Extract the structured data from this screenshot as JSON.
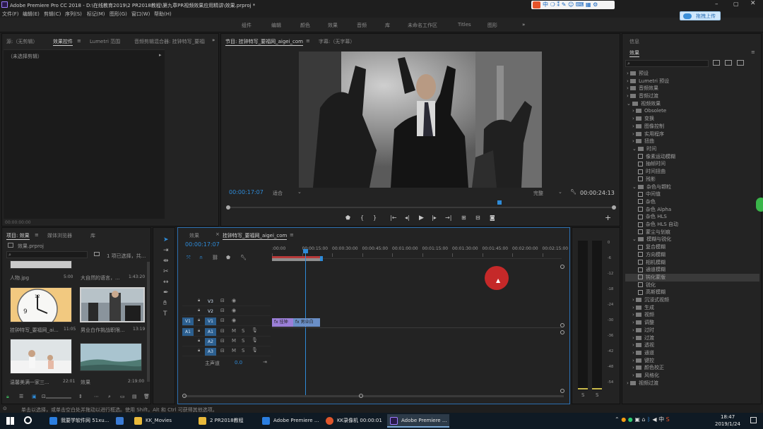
{
  "window": {
    "title": "Adobe Premiere Pro CC 2018 - D:\\在线教育2019\\2 PR2018教程\\第九章PR视频效果应用精讲\\效果.prproj *"
  },
  "menu": [
    "文件(F)",
    "编辑(E)",
    "剪辑(C)",
    "序列(S)",
    "标记(M)",
    "图形(G)",
    "窗口(W)",
    "帮助(H)"
  ],
  "workspaces": [
    "组件",
    "编辑",
    "颜色",
    "效果",
    "音频",
    "库",
    "未命名工作区",
    "Titles",
    "图形"
  ],
  "upload_button": "拖拽上传",
  "ime_bar": "中",
  "source_panel": {
    "tabs": [
      "源:（无剪辑）",
      "效果控件",
      "Lumetri 范围",
      "音频剪辑混合器: 挂钟特写_要福网_aigei_com"
    ],
    "no_clip": "（未选择剪辑）",
    "timecode": "00:00:00:00"
  },
  "program_panel": {
    "tabs": [
      "节目: 挂钟特写_要福网_aigei_com",
      "字幕:（无字幕）"
    ],
    "timecode": "00:00:17:07",
    "fit": "适合",
    "quality": "完整",
    "duration": "00:00:24:13"
  },
  "effects_panel": {
    "tab_info": "信息",
    "tab_effects": "效果",
    "search_placeholder": "",
    "tree": [
      {
        "label": "预设",
        "type": "folder",
        "indent": 1,
        "expanded": false
      },
      {
        "label": "Lumetri 预设",
        "type": "folder",
        "indent": 1,
        "expanded": false
      },
      {
        "label": "音频效果",
        "type": "folder",
        "indent": 1,
        "expanded": false
      },
      {
        "label": "音频过渡",
        "type": "folder",
        "indent": 1,
        "expanded": false
      },
      {
        "label": "视频效果",
        "type": "folder",
        "indent": 1,
        "expanded": true
      },
      {
        "label": "Obsolete",
        "type": "folder",
        "indent": 2,
        "expanded": false
      },
      {
        "label": "变换",
        "type": "folder",
        "indent": 2,
        "expanded": false
      },
      {
        "label": "图像控制",
        "type": "folder",
        "indent": 2,
        "expanded": false
      },
      {
        "label": "实用程序",
        "type": "folder",
        "indent": 2,
        "expanded": false
      },
      {
        "label": "扭曲",
        "type": "folder",
        "indent": 2,
        "expanded": false
      },
      {
        "label": "时间",
        "type": "folder",
        "indent": 2,
        "expanded": true
      },
      {
        "label": "像素运动模糊",
        "type": "effect",
        "indent": 3
      },
      {
        "label": "抽帧时间",
        "type": "effect",
        "indent": 3
      },
      {
        "label": "时间扭曲",
        "type": "effect",
        "indent": 3
      },
      {
        "label": "残影",
        "type": "effect",
        "indent": 3
      },
      {
        "label": "杂色与颗粒",
        "type": "folder",
        "indent": 2,
        "expanded": true
      },
      {
        "label": "中间值",
        "type": "effect",
        "indent": 3
      },
      {
        "label": "杂色",
        "type": "effect",
        "indent": 3
      },
      {
        "label": "杂色 Alpha",
        "type": "effect",
        "indent": 3
      },
      {
        "label": "杂色 HLS",
        "type": "effect",
        "indent": 3
      },
      {
        "label": "杂色 HLS 自动",
        "type": "effect",
        "indent": 3
      },
      {
        "label": "蒙尘与划痕",
        "type": "effect",
        "indent": 3
      },
      {
        "label": "模糊与锐化",
        "type": "folder",
        "indent": 2,
        "expanded": true
      },
      {
        "label": "复合模糊",
        "type": "effect",
        "indent": 3
      },
      {
        "label": "方向模糊",
        "type": "effect",
        "indent": 3
      },
      {
        "label": "相机模糊",
        "type": "effect",
        "indent": 3
      },
      {
        "label": "通道模糊",
        "type": "effect",
        "indent": 3
      },
      {
        "label": "钝化蒙版",
        "type": "effect",
        "indent": 3,
        "selected": true
      },
      {
        "label": "锐化",
        "type": "effect",
        "indent": 3
      },
      {
        "label": "高斯模糊",
        "type": "effect",
        "indent": 3
      },
      {
        "label": "沉浸式视频",
        "type": "folder",
        "indent": 2,
        "expanded": false
      },
      {
        "label": "生成",
        "type": "folder",
        "indent": 2,
        "expanded": false
      },
      {
        "label": "视频",
        "type": "folder",
        "indent": 2,
        "expanded": false
      },
      {
        "label": "调整",
        "type": "folder",
        "indent": 2,
        "expanded": false
      },
      {
        "label": "过时",
        "type": "folder",
        "indent": 2,
        "expanded": false
      },
      {
        "label": "过渡",
        "type": "folder",
        "indent": 2,
        "expanded": false
      },
      {
        "label": "透视",
        "type": "folder",
        "indent": 2,
        "expanded": false
      },
      {
        "label": "通道",
        "type": "folder",
        "indent": 2,
        "expanded": false
      },
      {
        "label": "键控",
        "type": "folder",
        "indent": 2,
        "expanded": false
      },
      {
        "label": "颜色校正",
        "type": "folder",
        "indent": 2,
        "expanded": false
      },
      {
        "label": "风格化",
        "type": "folder",
        "indent": 2,
        "expanded": false
      },
      {
        "label": "视频过渡",
        "type": "folder",
        "indent": 1,
        "expanded": false
      }
    ]
  },
  "project_panel": {
    "tabs": [
      "项目: 效果",
      "媒体浏览器",
      "库"
    ],
    "file": "效果.prproj",
    "selection": "1 项已选择，共...",
    "items": [
      {
        "name": "人物.jpg",
        "duration": "5:00"
      },
      {
        "name": "大自然的语言，...",
        "duration": "1:43:20"
      },
      {
        "name": "挂钟特写_要福网_ai...",
        "duration": "11:05"
      },
      {
        "name": "男业白作挑战职限...",
        "duration": "13:19"
      },
      {
        "name": "温馨美满一家三...",
        "duration": "22:01"
      },
      {
        "name": "效果",
        "duration": "2:19:00"
      }
    ]
  },
  "timeline_panel": {
    "tabs": [
      "效果",
      "挂钟特写_要福网_aigei_com"
    ],
    "timecode": "00:00:17:07",
    "ruler": [
      ":00:00",
      "00:00:15:00",
      "00:00:30:00",
      "00:00:45:00",
      "00:01:00:00",
      "00:01:15:00",
      "00:01:30:00",
      "00:01:45:00",
      "00:02:00:00",
      "00:02:15:00"
    ],
    "video_tracks": [
      "V3",
      "V2",
      "V1"
    ],
    "audio_tracks": [
      "A1",
      "A2",
      "A3"
    ],
    "master": "主声道",
    "master_value": "0.0",
    "clip_labels": [
      "挂钟",
      "男业白"
    ]
  },
  "audio_meter": {
    "scale": [
      "0",
      "-6",
      "-12",
      "-18",
      "-24",
      "-30",
      "-36",
      "-42",
      "-48",
      "-54"
    ],
    "solo": [
      "S",
      "S"
    ]
  },
  "status_bar": "单击以选择，或单击空白处并拖动以进行框选。使用 Shift，Alt 和 Ctrl 可获得其他选项。",
  "taskbar": {
    "items": [
      "我要学软件网 51xu...",
      "",
      "KK_Movies",
      "2 PR2018教程",
      "Adobe Premiere ...",
      "KK录像机 00:00:01",
      "Adobe Premiere ..."
    ],
    "tray": [
      "中"
    ],
    "time": "18:47",
    "date": "2019/1/24"
  },
  "colors": {
    "accent": "#2e8bd8",
    "timeline_border": "#2c6fb0",
    "clip_video": "#9b7fd8",
    "clip_video2": "#6a8fc7",
    "red_cursor": "#d42a2a",
    "selected_row": "#3a3a3a"
  }
}
